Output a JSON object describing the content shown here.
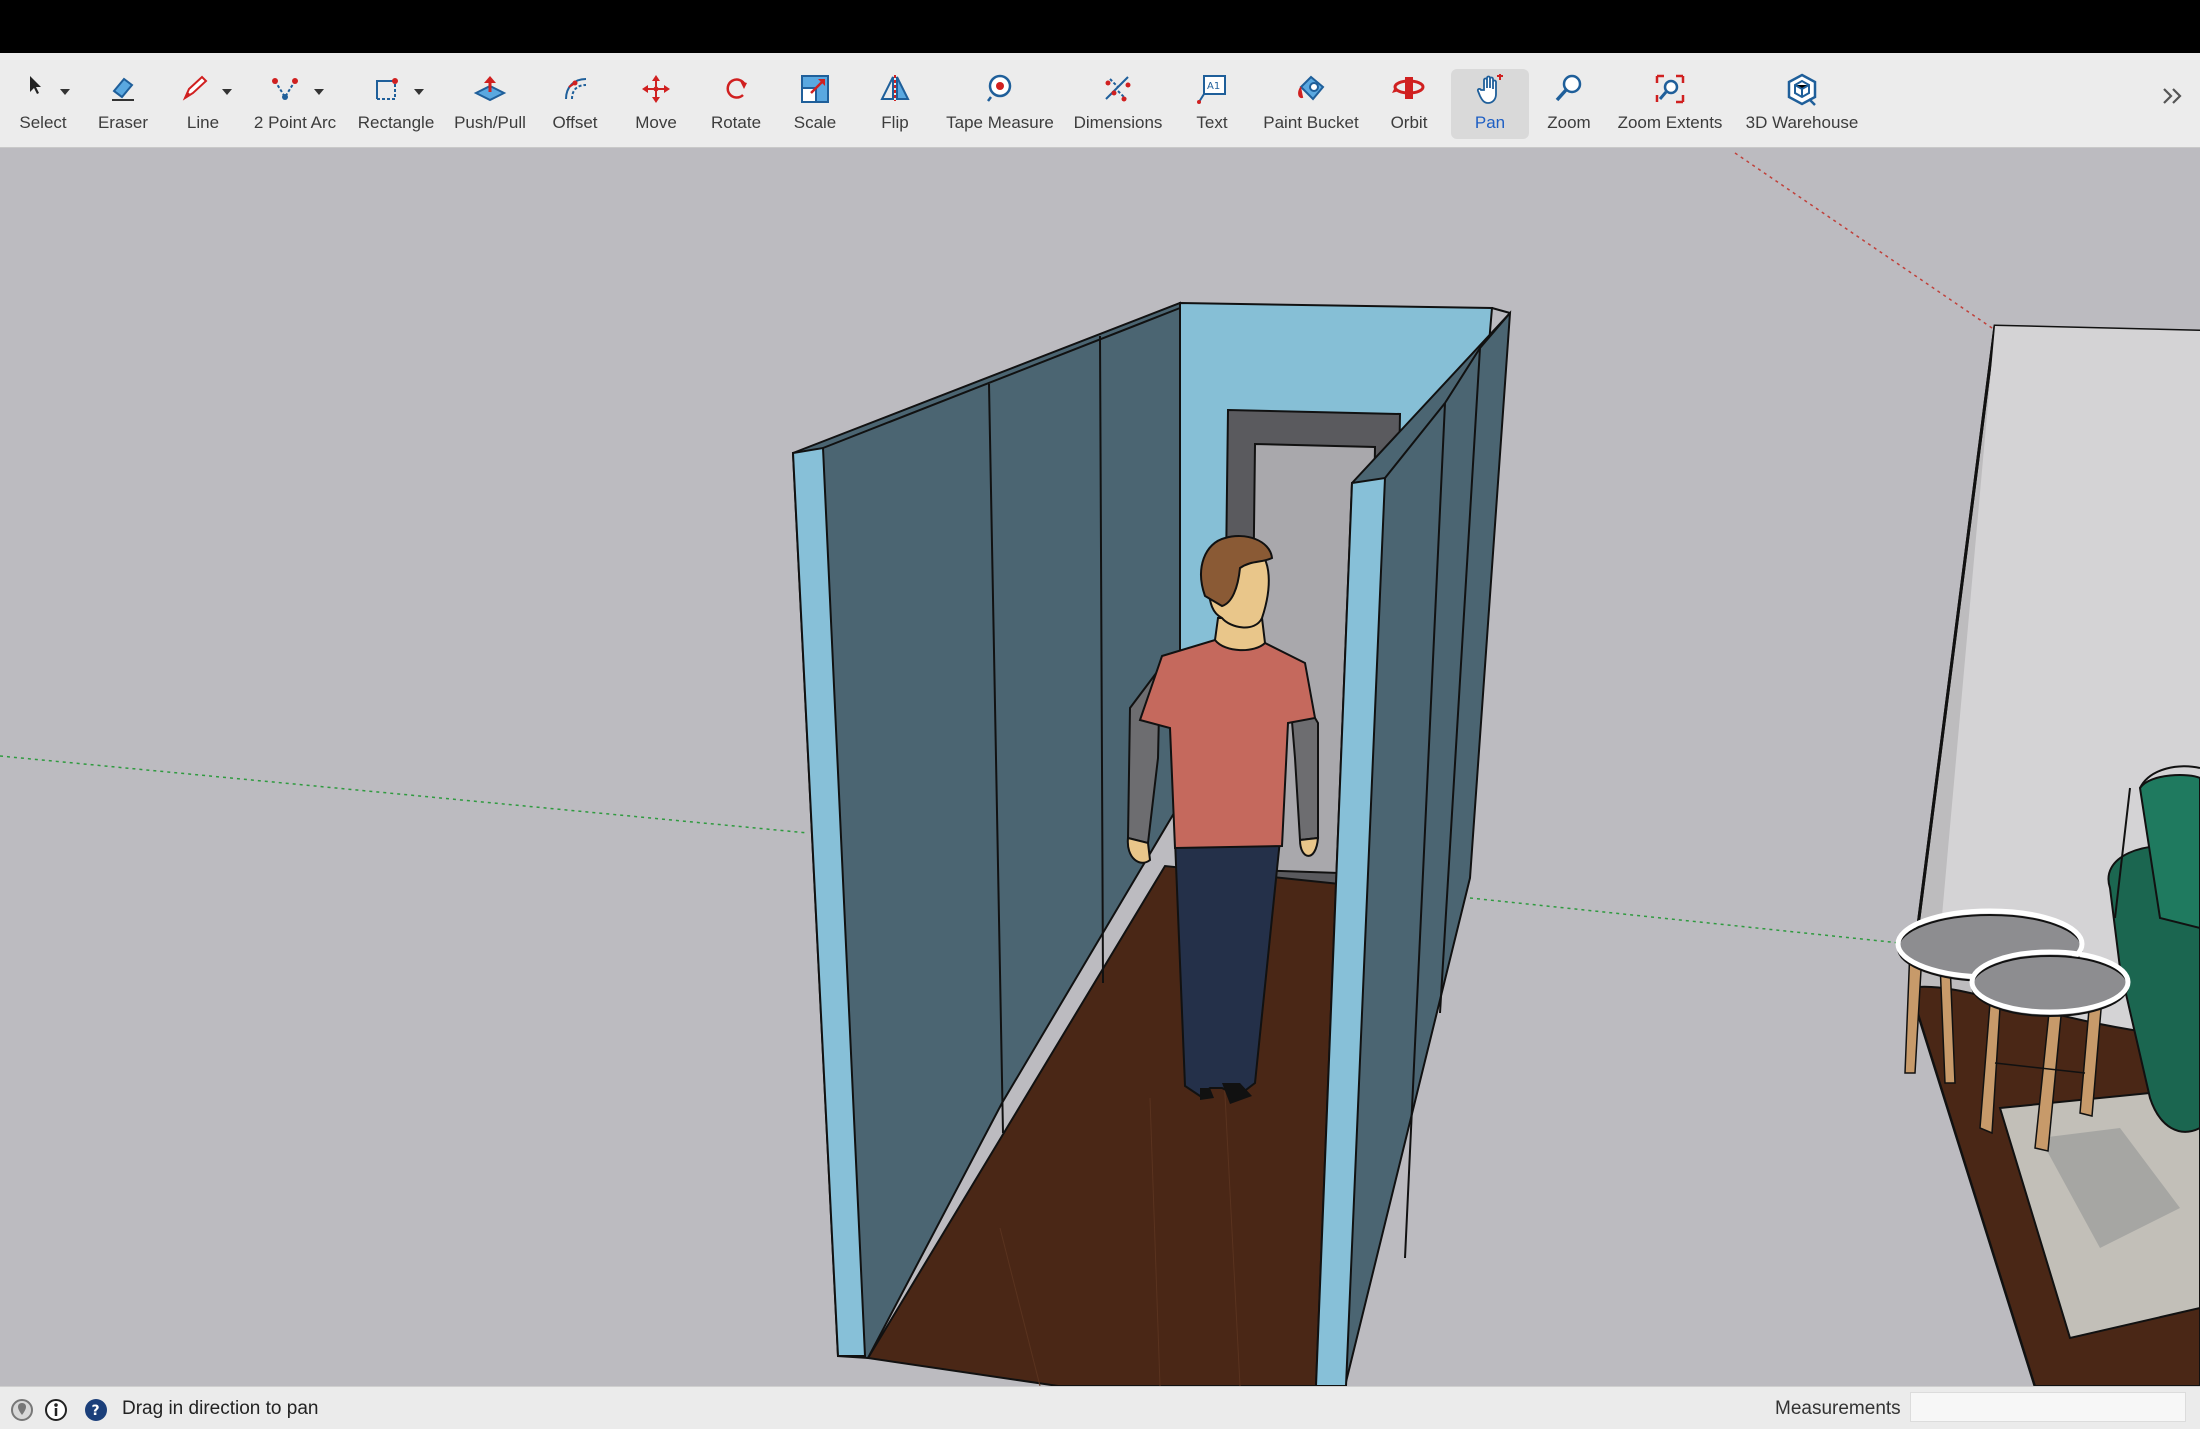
{
  "toolbar": {
    "tools": [
      {
        "label": "Select"
      },
      {
        "label": "Eraser"
      },
      {
        "label": "Line"
      },
      {
        "label": "2 Point Arc"
      },
      {
        "label": "Rectangle"
      },
      {
        "label": "Push/Pull"
      },
      {
        "label": "Offset"
      },
      {
        "label": "Move"
      },
      {
        "label": "Rotate"
      },
      {
        "label": "Scale"
      },
      {
        "label": "Flip"
      },
      {
        "label": "Tape Measure"
      },
      {
        "label": "Dimensions"
      },
      {
        "label": "Text"
      },
      {
        "label": "Paint Bucket"
      },
      {
        "label": "Orbit"
      },
      {
        "label": "Pan"
      },
      {
        "label": "Zoom"
      },
      {
        "label": "Zoom Extents"
      },
      {
        "label": "3D Warehouse"
      }
    ],
    "active_tool": "Pan",
    "accent_color": "#1e5fc4"
  },
  "status": {
    "message": "Drag in direction to pan",
    "measurements_label": "Measurements",
    "measurements_value": ""
  },
  "colors": {
    "wall_face": "#4b6572",
    "wall_edge": "#87c0d8",
    "floor": "#4a2716",
    "background": "#bcbbc0"
  }
}
